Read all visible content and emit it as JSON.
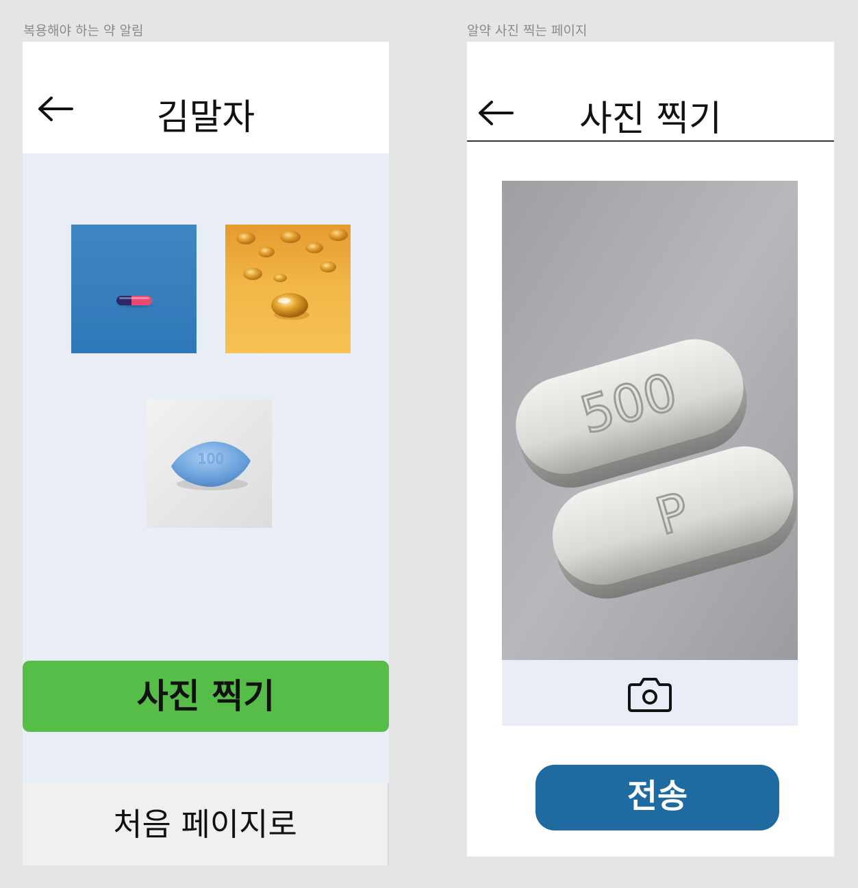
{
  "frames": [
    {
      "label": "복용해야 하는 약 알림",
      "header": {
        "back_icon": "arrow-left-icon",
        "title": "김말자"
      },
      "pills": [
        {
          "icon": "capsule-pill-image"
        },
        {
          "icon": "softgel-pill-image"
        },
        {
          "icon": "tablet-pill-image",
          "imprint": "100"
        }
      ],
      "take_photo_label": "사진 찍기",
      "home_label": "처음 페이지로"
    },
    {
      "label": "알약 사진 찍는 페이지",
      "header": {
        "back_icon": "arrow-left-icon",
        "title": "사진 찍기"
      },
      "preview": {
        "pill_imprints": [
          "500",
          "P"
        ]
      },
      "camera_icon": "camera-icon",
      "send_label": "전송"
    }
  ],
  "colors": {
    "background": "#e5e5e5",
    "content_bg": "#e9eef6",
    "take_photo_button": "#56be48",
    "send_button": "#1f6aa0",
    "footer_bg": "#f0f0f0"
  }
}
